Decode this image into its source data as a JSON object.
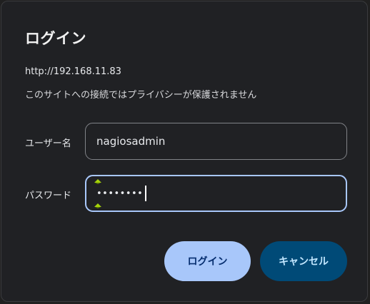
{
  "dialog": {
    "title": "ログイン",
    "origin": "http://192.168.11.83",
    "warning": "このサイトへの接続ではプライバシーが保護されません"
  },
  "username": {
    "label": "ユーザー名",
    "value": "nagiosadmin"
  },
  "password": {
    "label": "パスワード",
    "masked_value": "••••••••"
  },
  "buttons": {
    "login_label": "ログイン",
    "cancel_label": "キャンセル"
  },
  "colors": {
    "dialog_bg": "#202124",
    "primary_button": "#a8c7fa",
    "secondary_button": "#004a77",
    "focus_ring": "#a8c7fa",
    "autofill_marker": "#a6d40a"
  },
  "icons": {
    "autofill_marker_top": "autofill-marker-icon",
    "autofill_marker_bottom": "autofill-marker-icon"
  }
}
